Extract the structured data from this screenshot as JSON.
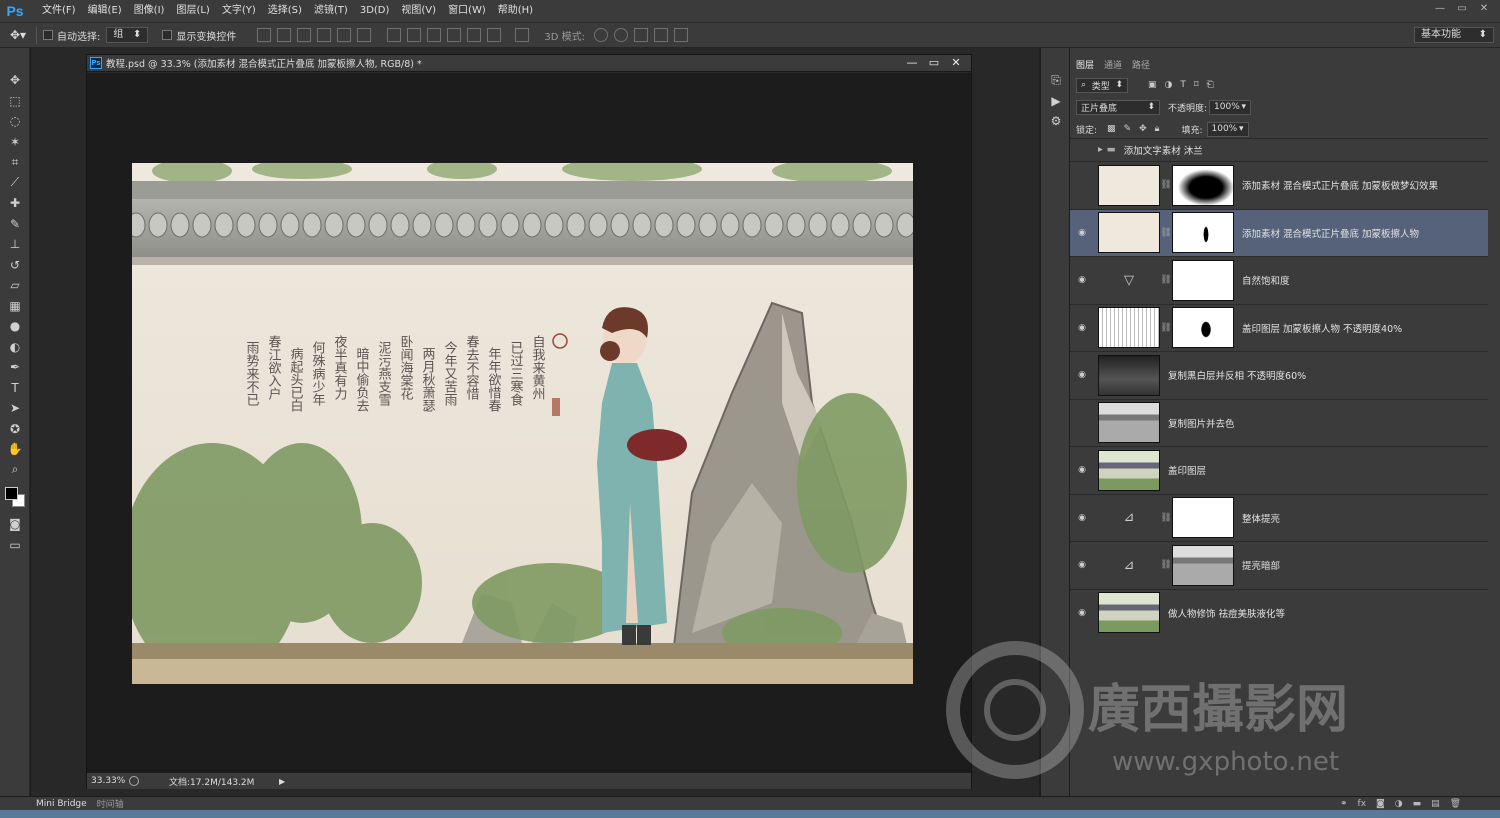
{
  "app": {
    "logo": "Ps"
  },
  "menu": [
    "文件(F)",
    "编辑(E)",
    "图像(I)",
    "图层(L)",
    "文字(Y)",
    "选择(S)",
    "滤镜(T)",
    "3D(D)",
    "视图(V)",
    "窗口(W)",
    "帮助(H)"
  ],
  "window_controls": [
    "—",
    "▭",
    "✕"
  ],
  "options": {
    "auto_select_label": "自动选择:",
    "auto_select_value": "组",
    "show_transform_label": "显示变换控件",
    "mode3d_label": "3D 模式:",
    "workspace_value": "基本功能"
  },
  "document": {
    "title": "教程.psd @ 33.3% (添加素材  混合模式正片叠底   加蒙板擦人物, RGB/8) *",
    "icon_label": "Ps",
    "zoom": "33.33%",
    "doc_size": "文档:17.2M/143.2M"
  },
  "layers_panel": {
    "tabs": [
      "图层",
      "通道",
      "路径"
    ],
    "filter_kind": "类型",
    "blend_mode": "正片叠底",
    "opacity_label": "不透明度:",
    "opacity_value": "100%",
    "lock_label": "锁定:",
    "fill_label": "填充:",
    "fill_value": "100%",
    "group_name": "添加文字素材  沐兰",
    "layers": [
      {
        "name": "添加素材  混合模式正片叠底   加蒙板做梦幻效果",
        "visible": false,
        "selected": false,
        "thumb": "paper",
        "mask": "cloud",
        "adj": ""
      },
      {
        "name": "添加素材  混合模式正片叠底   加蒙板擦人物",
        "visible": true,
        "selected": true,
        "thumb": "paper",
        "mask": "figure",
        "adj": ""
      },
      {
        "name": "自然饱和度",
        "visible": true,
        "selected": false,
        "thumb": "",
        "mask": "white",
        "adj": "▽"
      },
      {
        "name": "盖印图层  加蒙板擦人物    不透明度40%",
        "visible": true,
        "selected": false,
        "thumb": "sketch",
        "mask": "figure-dark",
        "adj": ""
      },
      {
        "name": "复制黑白层并反相    不透明度60%",
        "visible": true,
        "selected": false,
        "thumb": "dark",
        "mask": "",
        "adj": ""
      },
      {
        "name": "复制图片并去色",
        "visible": false,
        "selected": false,
        "thumb": "gray",
        "mask": "",
        "adj": ""
      },
      {
        "name": "盖印图层",
        "visible": true,
        "selected": false,
        "thumb": "color",
        "mask": "",
        "adj": ""
      },
      {
        "name": "整体提亮",
        "visible": true,
        "selected": false,
        "thumb": "",
        "mask": "white",
        "adj": "⊿"
      },
      {
        "name": "提亮暗部",
        "visible": true,
        "selected": false,
        "thumb": "",
        "mask": "gray",
        "adj": "⊿"
      },
      {
        "name": "做人物修饰  祛痘美肤液化等",
        "visible": true,
        "selected": false,
        "thumb": "color",
        "mask": "",
        "adj": ""
      }
    ]
  },
  "footer": {
    "mini_bridge": "Mini Bridge",
    "timeline": "时间轴"
  },
  "watermark": {
    "text_cn": "廣西攝影网",
    "url": "www.gxphoto.net"
  },
  "photo_poem": [
    "自我来黄州",
    "已过三寒食",
    "年年欲惜春",
    "春去不容惜",
    "今年又苦雨",
    "两月秋萧瑟",
    "卧闻海棠花",
    "泥污燕支雪",
    "暗中偷负去",
    "夜半真有力",
    "何殊病少年",
    "病起头已白",
    "春江欲入户",
    "雨势来不已"
  ]
}
